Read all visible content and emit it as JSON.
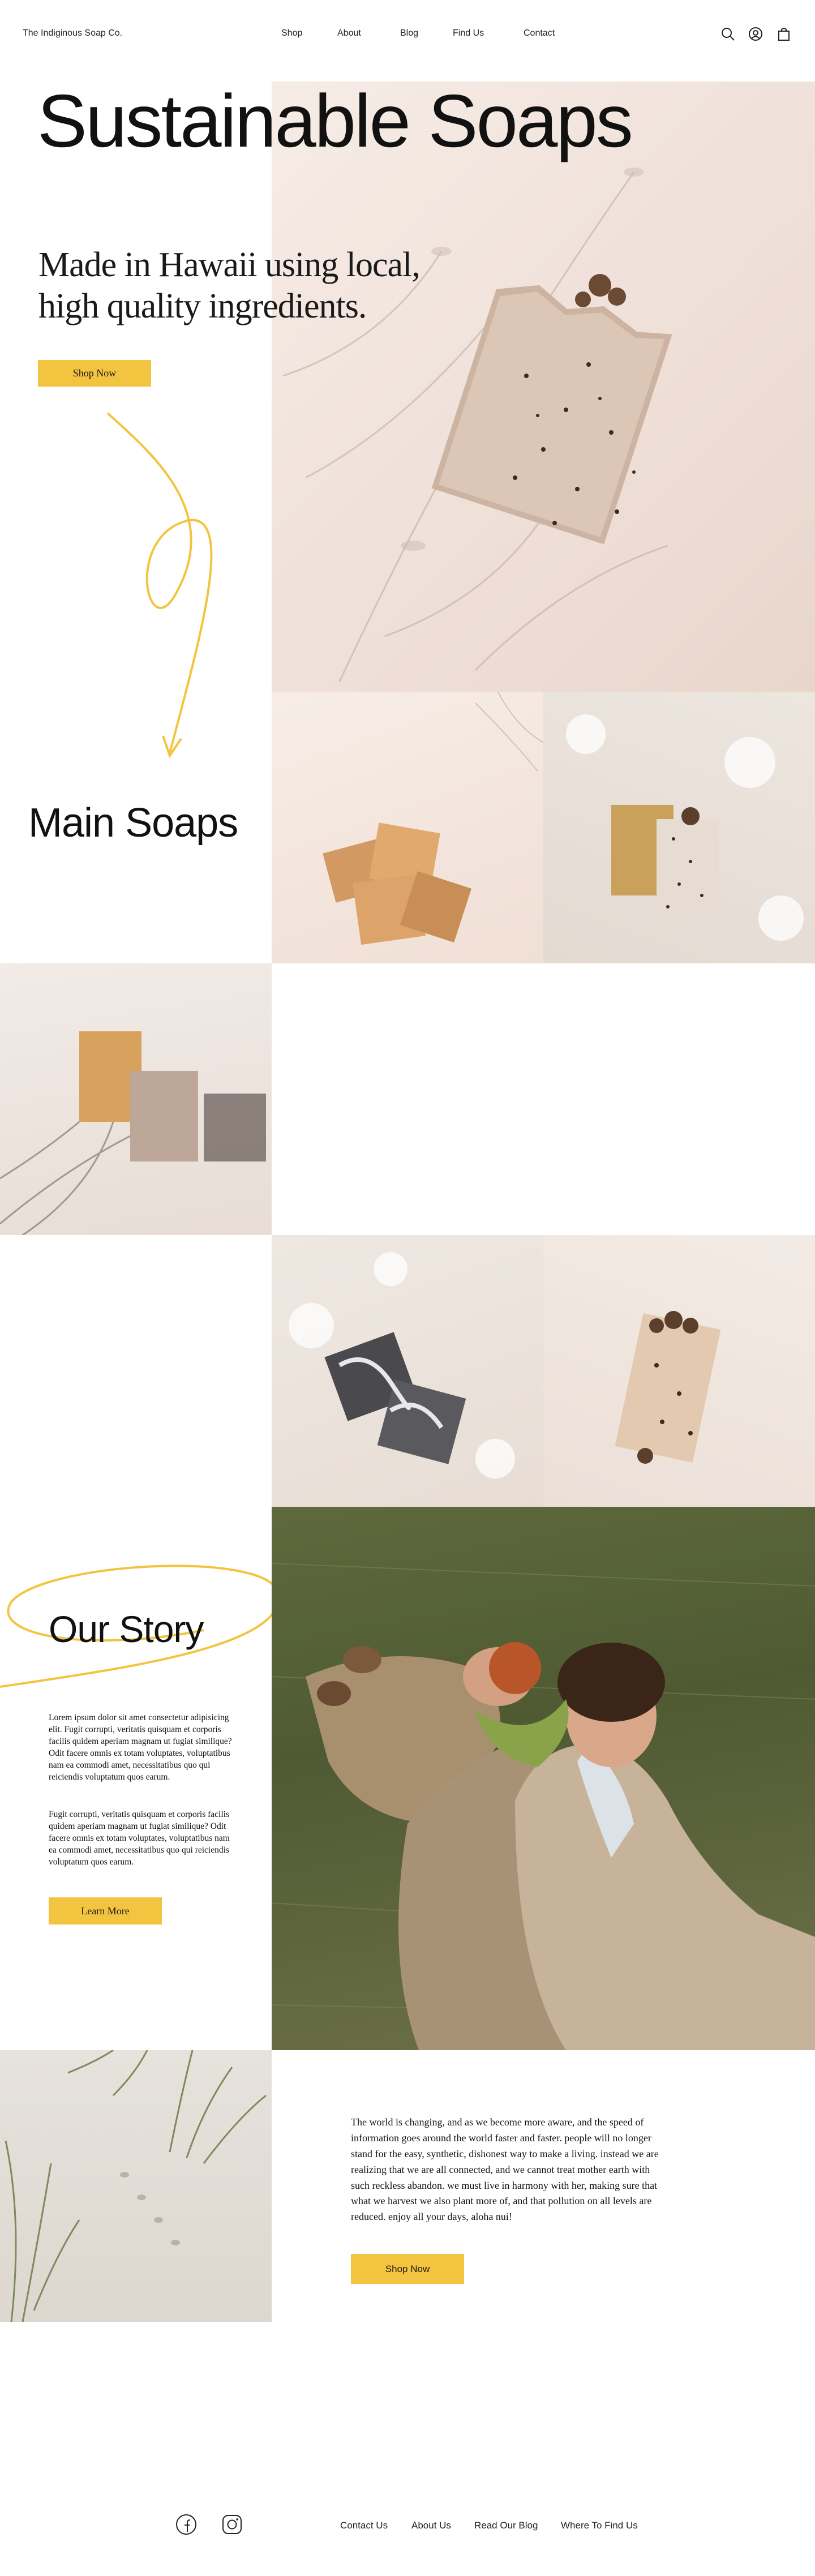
{
  "header": {
    "brand": "The Indiginous Soap Co.",
    "nav": [
      "Shop",
      "About",
      "Blog",
      "Find Us",
      "Contact"
    ],
    "icons": [
      "search-icon",
      "account-icon",
      "cart-icon"
    ]
  },
  "hero": {
    "title": "Sustainable Soaps",
    "subtitle": "Made in Hawaii using local, high quality ingredients.",
    "button": "Shop Now"
  },
  "main_soaps": {
    "title": "Main Soaps"
  },
  "story": {
    "title": "Our Story",
    "paragraph1": "Lorem ipsum dolor sit amet consectetur adipisicing elit. Fugit corrupti, veritatis quisquam et corporis facilis quidem aperiam magnam ut fugiat similique? Odit facere omnis ex totam voluptates, voluptatibus nam ea commodi amet, necessitatibus quo qui reiciendis  voluptatum quos earum.",
    "paragraph2": "Fugit corrupti, veritatis quisquam et corporis facilis quidem aperiam magnam ut fugiat similique? Odit facere omnis ex totam voluptates, voluptatibus nam ea commodi amet, necessitatibus quo qui reiciendis  voluptatum quos earum.",
    "button": "Learn More"
  },
  "mission": {
    "text": "The world is changing, and as we become more aware, and the speed of information goes around the world faster and faster. people will no longer stand for the easy, synthetic, dishonest way to make a living. instead we are realizing that we are all connected, and we cannot treat mother earth with such reckless abandon. we must live in harmony with her, making sure that what we harvest we also plant more of, and that pollution on all levels are reduced. enjoy all your days, aloha nui!",
    "button": "Shop Now"
  },
  "footer": {
    "social_icons": [
      "facebook-icon",
      "instagram-icon"
    ],
    "links": [
      "Contact Us",
      "About Us",
      "Read Our Blog",
      "Where To Find Us"
    ]
  },
  "colors": {
    "accent": "#f2c440",
    "text": "#111111",
    "background": "#ffffff"
  }
}
